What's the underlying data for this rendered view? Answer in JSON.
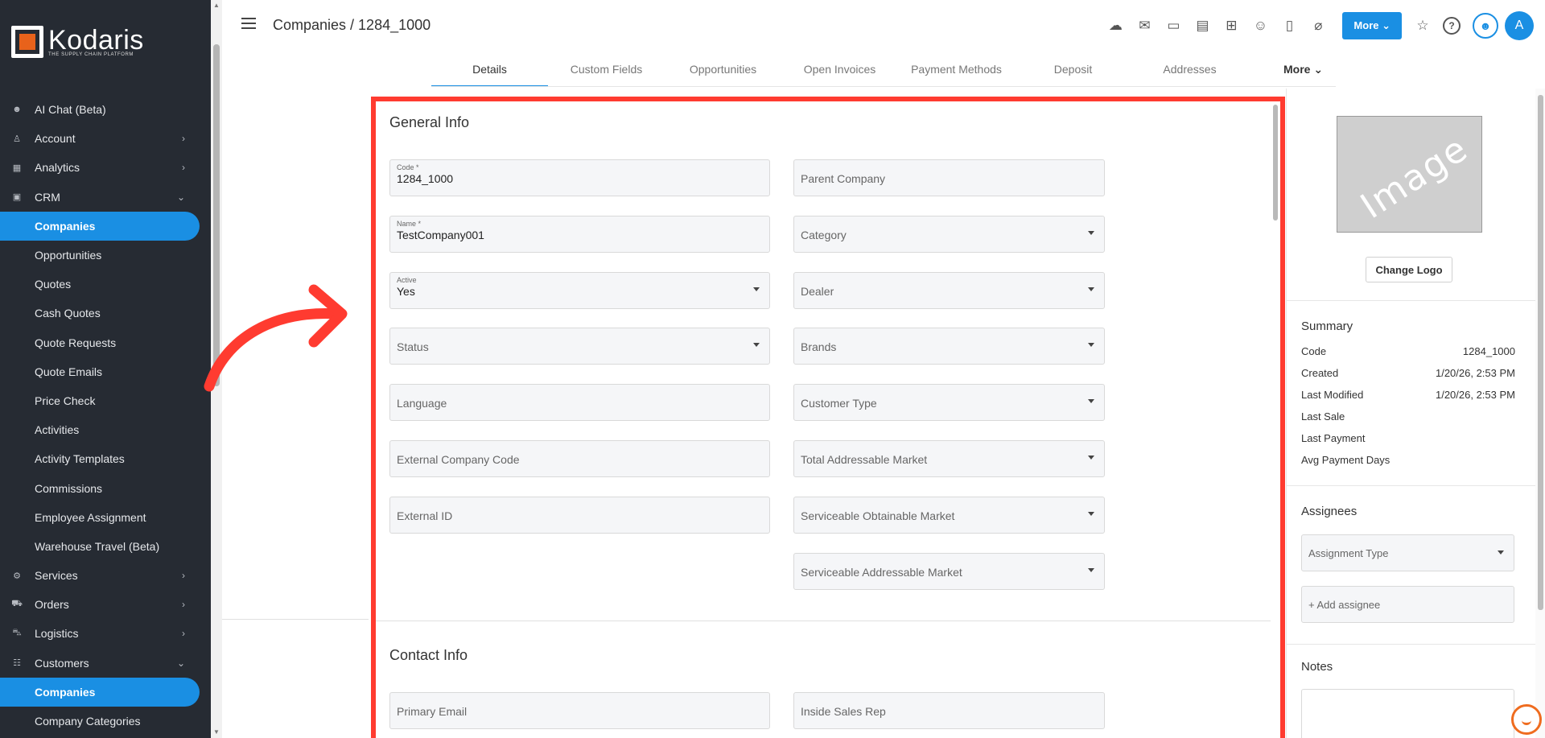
{
  "brand": {
    "name": "Kodaris",
    "tagline": "THE SUPPLY CHAIN PLATFORM",
    "accent": "#1a8fe3",
    "frame_color": "#ff3b30"
  },
  "sidebar": {
    "items": [
      {
        "label": "AI Chat (Beta)",
        "icon": "robot-icon",
        "glyph": "☻"
      },
      {
        "label": "Account",
        "icon": "person-icon",
        "glyph": "♙",
        "chevron": "›"
      },
      {
        "label": "Analytics",
        "icon": "chart-icon",
        "glyph": "▦",
        "chevron": "›"
      },
      {
        "label": "CRM",
        "icon": "briefcase-icon",
        "glyph": "▣",
        "chevron": "⌄"
      },
      {
        "label": "Companies",
        "sub": true,
        "active": true
      },
      {
        "label": "Opportunities",
        "sub": true
      },
      {
        "label": "Quotes",
        "sub": true
      },
      {
        "label": "Cash Quotes",
        "sub": true
      },
      {
        "label": "Quote Requests",
        "sub": true
      },
      {
        "label": "Quote Emails",
        "sub": true
      },
      {
        "label": "Price Check",
        "sub": true
      },
      {
        "label": "Activities",
        "sub": true
      },
      {
        "label": "Activity Templates",
        "sub": true
      },
      {
        "label": "Commissions",
        "sub": true
      },
      {
        "label": "Employee Assignment",
        "sub": true
      },
      {
        "label": "Warehouse Travel (Beta)",
        "sub": true
      },
      {
        "label": "Services",
        "icon": "gears-icon",
        "glyph": "⚙",
        "chevron": "›"
      },
      {
        "label": "Orders",
        "icon": "truck-icon",
        "glyph": "⛟",
        "chevron": "›"
      },
      {
        "label": "Logistics",
        "icon": "shipping-icon",
        "glyph": "⛍",
        "chevron": "›"
      },
      {
        "label": "Customers",
        "icon": "people-icon",
        "glyph": "☷",
        "chevron": "⌄"
      },
      {
        "label": "Companies",
        "sub": true,
        "active": true
      },
      {
        "label": "Company Categories",
        "sub": true
      }
    ]
  },
  "header": {
    "title": "Companies / 1284_1000",
    "more_label": "More ⌄",
    "avatar_initial": "A",
    "icons": [
      {
        "name": "cloud-upload-icon",
        "glyph": "☁"
      },
      {
        "name": "mail-icon",
        "glyph": "✉"
      },
      {
        "name": "card-check-icon",
        "glyph": "▭"
      },
      {
        "name": "gift-icon",
        "glyph": "▤"
      },
      {
        "name": "presentation-add-icon",
        "glyph": "⊞"
      },
      {
        "name": "person-add-icon",
        "glyph": "☺"
      },
      {
        "name": "document-add-icon",
        "glyph": "▯"
      },
      {
        "name": "attachment-icon",
        "glyph": "⌀"
      }
    ],
    "star_glyph": "☆",
    "help_glyph": "?",
    "bot_glyph": "☻"
  },
  "tabs": [
    "Details",
    "Custom Fields",
    "Opportunities",
    "Open Invoices",
    "Payment Methods",
    "Deposit",
    "Addresses",
    "More ⌄"
  ],
  "general_info": {
    "title": "General Info",
    "left": [
      {
        "label": "Code *",
        "value": "1284_1000"
      },
      {
        "label": "Name *",
        "value": "TestCompany001"
      },
      {
        "label": "Active",
        "value": "Yes",
        "select": true
      },
      {
        "placeholder": "Status",
        "select": true
      },
      {
        "placeholder": "Language"
      },
      {
        "placeholder": "External Company Code"
      },
      {
        "placeholder": "External ID"
      }
    ],
    "right": [
      {
        "placeholder": "Parent Company"
      },
      {
        "placeholder": "Category",
        "select": true
      },
      {
        "placeholder": "Dealer",
        "select": true
      },
      {
        "placeholder": "Brands",
        "select": true
      },
      {
        "placeholder": "Customer Type",
        "select": true
      },
      {
        "placeholder": "Total Addressable Market",
        "select": true
      },
      {
        "placeholder": "Serviceable Obtainable Market",
        "select": true
      },
      {
        "placeholder": "Serviceable Addressable Market",
        "select": true
      }
    ]
  },
  "contact_info": {
    "title": "Contact Info",
    "left": [
      {
        "placeholder": "Primary Email"
      }
    ],
    "right": [
      {
        "placeholder": "Inside Sales Rep"
      }
    ]
  },
  "right_panel": {
    "image_text": "Image",
    "change_logo": "Change Logo",
    "summary_title": "Summary",
    "summary": [
      {
        "k": "Code",
        "v": "1284_1000"
      },
      {
        "k": "Created",
        "v": "1/20/26, 2:53 PM"
      },
      {
        "k": "Last Modified",
        "v": "1/20/26, 2:53 PM"
      },
      {
        "k": "Last Sale",
        "v": ""
      },
      {
        "k": "Last Payment",
        "v": ""
      },
      {
        "k": "Avg Payment Days",
        "v": ""
      }
    ],
    "assignees_title": "Assignees",
    "assignment_type": "Assignment Type",
    "add_assignee": "+ Add assignee",
    "notes_title": "Notes"
  }
}
